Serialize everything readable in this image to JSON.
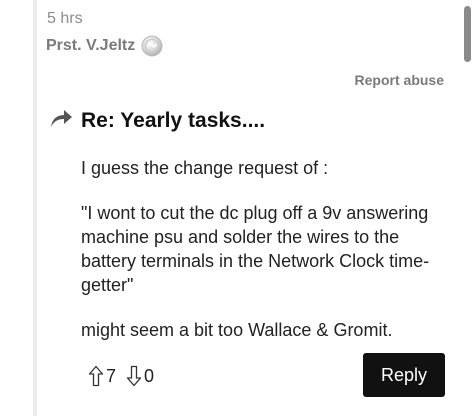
{
  "post": {
    "time": "5 hrs",
    "author": "Prst. V.Jeltz",
    "report_label": "Report abuse",
    "subject": "Re: Yearly tasks....",
    "paragraphs": [
      "I guess the change request of :",
      "\"I wont to cut the dc plug off a 9v answering machine psu and solder the wires to the battery terminals in the Network Clock time-getter\"",
      "might seem a bit too Wallace & Gromit."
    ],
    "votes": {
      "up": "7",
      "down": "0"
    },
    "reply_label": "Reply"
  },
  "icons": {
    "author_badge": "silver-medal-icon",
    "subject_prefix": "reply-arrow-icon",
    "upvote": "arrow-up-icon",
    "downvote": "arrow-down-icon"
  },
  "colors": {
    "muted_text": "#7a7a7a",
    "body_text": "#222222",
    "reply_button_bg": "#111111",
    "reply_button_text": "#ffffff"
  }
}
